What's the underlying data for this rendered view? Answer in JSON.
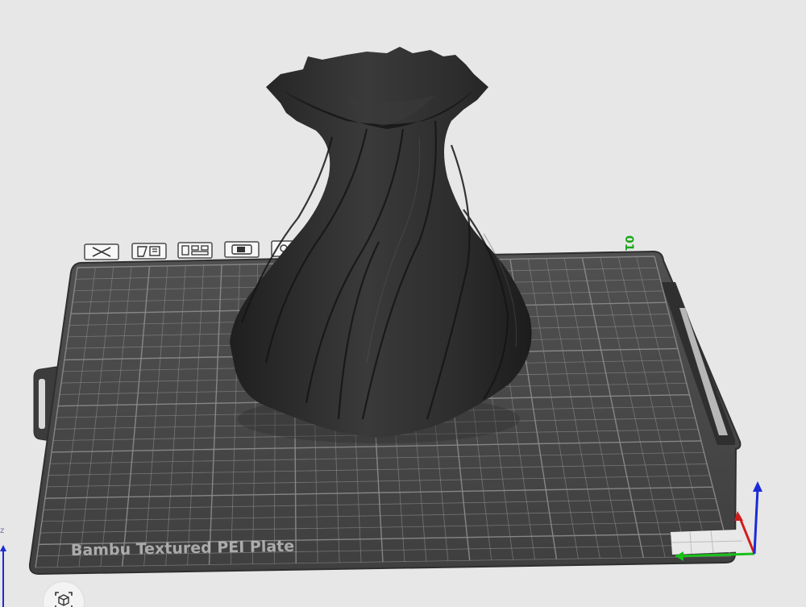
{
  "viewport": {
    "plate_label": "Bambu Textured PEI Plate",
    "plate_number": "01",
    "left_axis_label": "z"
  },
  "toolbar": {
    "buttons": [
      {
        "name": "delete-plate-button",
        "icon": "close-x-icon"
      },
      {
        "name": "arrange-button",
        "icon": "auto-orient-icon"
      },
      {
        "name": "arrange-layout-button",
        "icon": "arrange-grid-icon"
      },
      {
        "name": "lock-plate-button",
        "icon": "lock-icon"
      },
      {
        "name": "plate-settings-button",
        "icon": "settings-icon"
      }
    ]
  },
  "colors": {
    "background": "#e7e7e7",
    "plate": "#4a4a4a",
    "grid": "#8a8a8a",
    "model": "#2b2b2b",
    "plate_number": "#19a619",
    "axis_x": "#d11c1c",
    "axis_y": "#19c019",
    "axis_z": "#1c2bd6"
  }
}
